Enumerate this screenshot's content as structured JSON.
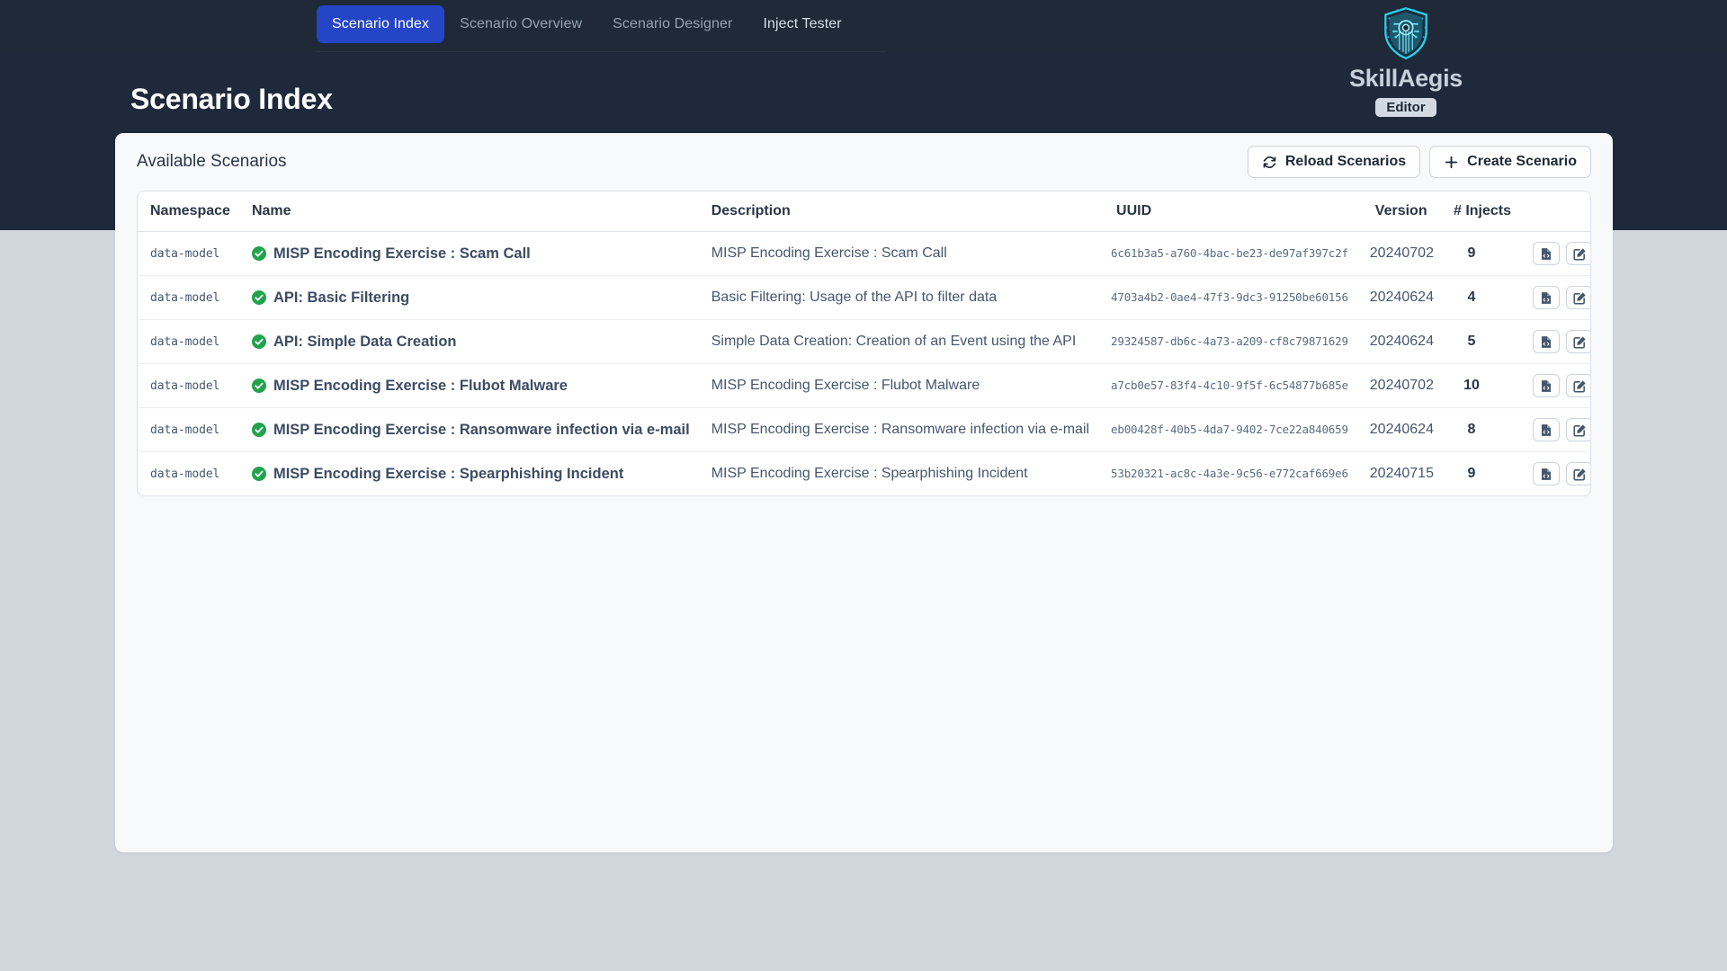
{
  "nav": {
    "tabs": [
      {
        "label": "Scenario Index",
        "state": "active"
      },
      {
        "label": "Scenario Overview",
        "state": "inactive"
      },
      {
        "label": "Scenario Designer",
        "state": "inactive"
      },
      {
        "label": "Inject Tester",
        "state": "bright"
      }
    ]
  },
  "brand": {
    "name": "SkillAegis",
    "badge": "Editor",
    "logo_icon": "shield-circuit-icon",
    "logo_color": "#22d3ee"
  },
  "page": {
    "title": "Scenario Index"
  },
  "card": {
    "title": "Available Scenarios",
    "reload_button": {
      "label": "Reload Scenarios",
      "icon": "rotate-icon"
    },
    "create_button": {
      "label": "Create Scenario",
      "icon": "plus-icon"
    }
  },
  "table": {
    "columns": [
      "Namespace",
      "Name",
      "Description",
      "UUID",
      "Version",
      "# Injects"
    ],
    "row_action_icons": [
      "file-code-icon",
      "pen-to-square-icon",
      "trash-icon"
    ],
    "rows": [
      {
        "namespace": "data-model",
        "status_icon": "circle-check-icon",
        "name": "MISP Encoding Exercise : Scam Call",
        "description": "MISP Encoding Exercise : Scam Call",
        "uuid": "6c61b3a5-a760-4bac-be23-de97af397c2f",
        "version": "20240702",
        "injects": "9"
      },
      {
        "namespace": "data-model",
        "status_icon": "circle-check-icon",
        "name": "API: Basic Filtering",
        "description": "Basic Filtering: Usage of the API to filter data",
        "uuid": "4703a4b2-0ae4-47f3-9dc3-91250be60156",
        "version": "20240624",
        "injects": "4"
      },
      {
        "namespace": "data-model",
        "status_icon": "circle-check-icon",
        "name": "API: Simple Data Creation",
        "description": "Simple Data Creation: Creation of an Event using the API",
        "uuid": "29324587-db6c-4a73-a209-cf8c79871629",
        "version": "20240624",
        "injects": "5"
      },
      {
        "namespace": "data-model",
        "status_icon": "circle-check-icon",
        "name": "MISP Encoding Exercise : Flubot Malware",
        "description": "MISP Encoding Exercise : Flubot Malware",
        "uuid": "a7cb0e57-83f4-4c10-9f5f-6c54877b685e",
        "version": "20240702",
        "injects": "10"
      },
      {
        "namespace": "data-model",
        "status_icon": "circle-check-icon",
        "name": "MISP Encoding Exercise : Ransomware infection via e-mail",
        "description": "MISP Encoding Exercise : Ransomware infection via e-mail",
        "uuid": "eb00428f-40b5-4da7-9402-7ce22a840659",
        "version": "20240624",
        "injects": "8"
      },
      {
        "namespace": "data-model",
        "status_icon": "circle-check-icon",
        "name": "MISP Encoding Exercise : Spearphishing Incident",
        "description": "MISP Encoding Exercise : Spearphishing Incident",
        "uuid": "53b20321-ac8c-4a3e-9c56-e772caf669e6",
        "version": "20240715",
        "injects": "9"
      }
    ]
  },
  "colors": {
    "header_bg": "#1e293b",
    "nav_bg": "#1f2937",
    "active_tab": "#2545c7",
    "page_bg": "#d2d6dd",
    "card_bg": "#f8f9fb",
    "status_green": "#22a24c",
    "accent_cyan": "#22d3ee"
  }
}
